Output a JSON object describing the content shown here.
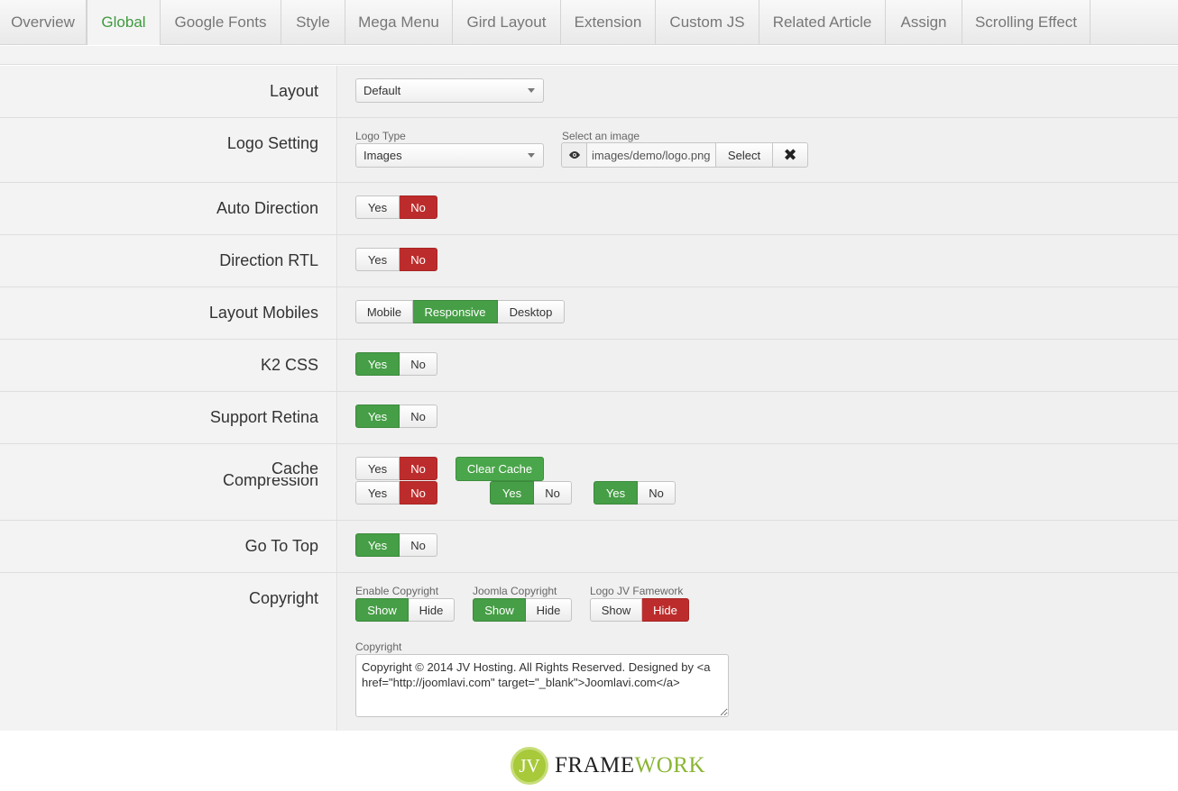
{
  "tabs": [
    {
      "label": "Overview"
    },
    {
      "label": "Global"
    },
    {
      "label": "Google Fonts"
    },
    {
      "label": "Style"
    },
    {
      "label": "Mega Menu"
    },
    {
      "label": "Gird Layout"
    },
    {
      "label": "Extension"
    },
    {
      "label": "Custom JS"
    },
    {
      "label": "Related Article"
    },
    {
      "label": "Assign"
    },
    {
      "label": "Scrolling Effect"
    }
  ],
  "active_tab": "Global",
  "rows": {
    "layout": {
      "label": "Layout",
      "value": "Default"
    },
    "logo": {
      "label": "Logo Setting",
      "type_label": "Logo Type",
      "type_value": "Images",
      "image_label": "Select an image",
      "image_path": "images/demo/logo.png",
      "select_label": "Select",
      "clear_icon": "close-icon"
    },
    "auto_direction": {
      "label": "Auto Direction",
      "yes": "Yes",
      "no": "No",
      "selected": "No"
    },
    "direction_rtl": {
      "label": "Direction RTL",
      "yes": "Yes",
      "no": "No",
      "selected": "No"
    },
    "layout_mobiles": {
      "label": "Layout Mobiles",
      "mobile": "Mobile",
      "responsive": "Responsive",
      "desktop": "Desktop",
      "selected": "Responsive"
    },
    "k2_css": {
      "label": "K2 CSS",
      "yes": "Yes",
      "no": "No",
      "selected": "Yes"
    },
    "support_retina": {
      "label": "Support Retina",
      "yes": "Yes",
      "no": "No",
      "selected": "Yes"
    },
    "cache": {
      "label": "Cache",
      "label_overlap": "Compression",
      "yes": "Yes",
      "no": "No",
      "selected": "No",
      "clear_cache": "Clear Cache",
      "compression": {
        "yes": "Yes",
        "no": "No",
        "selected": "No"
      },
      "compression_2": {
        "yes": "Yes",
        "no": "No",
        "selected": "Yes"
      },
      "compression_3": {
        "yes": "Yes",
        "no": "No",
        "selected": "Yes"
      }
    },
    "go_to_top": {
      "label": "Go To Top",
      "yes": "Yes",
      "no": "No",
      "selected": "Yes"
    },
    "copyright": {
      "label": "Copyright",
      "enable_label": "Enable Copyright",
      "enable": {
        "show": "Show",
        "hide": "Hide",
        "selected": "Show"
      },
      "joomla_label": "Joomla Copyright",
      "joomla": {
        "show": "Show",
        "hide": "Hide",
        "selected": "Show"
      },
      "logo_label": "Logo JV Famework",
      "logo": {
        "show": "Show",
        "hide": "Hide",
        "selected": "Hide"
      },
      "text_label": "Copyright",
      "text_value": "Copyright © 2014 JV Hosting. All Rights Reserved. Designed by <a href=\"http://joomlavi.com\" target=\"_blank\">Joomlavi.com</a>"
    }
  },
  "footer": {
    "mark": "JV",
    "word_a": "FRAME",
    "word_b": "WORK"
  },
  "colors": {
    "green": "#469e46",
    "red": "#bd2c2c",
    "active_tab_text": "#3f9a3f",
    "logo_green": "#8bb534"
  }
}
